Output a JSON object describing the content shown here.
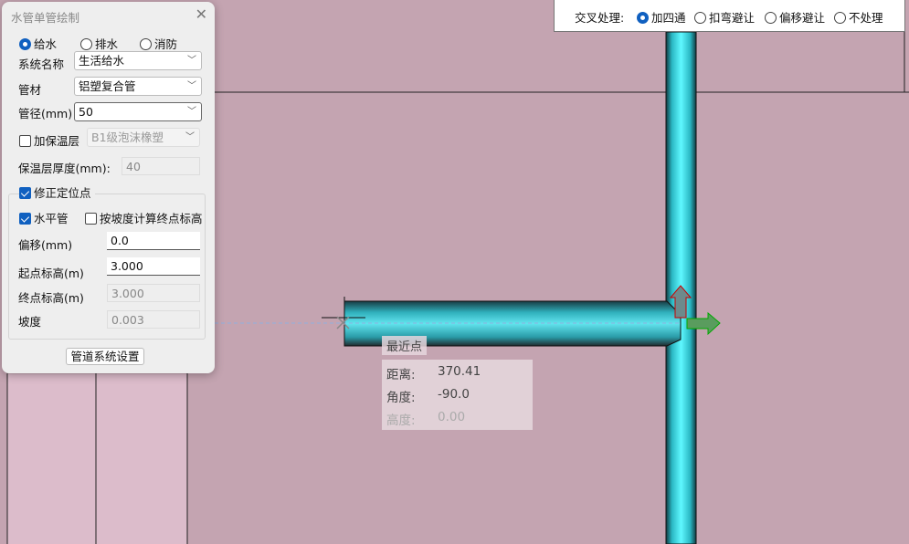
{
  "dialog": {
    "title": "水管单管绘制",
    "close": "✕",
    "types": [
      "给水",
      "排水",
      "消防"
    ],
    "system_label": "系统名称",
    "system_value": "生活给水",
    "material_label": "管材",
    "material_value": "铝塑复合管",
    "diameter_label": "管径(mm)",
    "diameter_value": "50",
    "insulation_label": "加保温层",
    "insulation_value": "B1级泡沫橡塑",
    "thickness_label": "保温层厚度(mm):",
    "thickness_value": "40",
    "fix_point_label": "修正定位点",
    "horizontal_label": "水平管",
    "slope_calc_label": "按坡度计算终点标高",
    "offset_label": "偏移(mm)",
    "offset_value": "0.0",
    "start_label": "起点标高(m)",
    "start_value": "3.000",
    "end_label": "终点标高(m)",
    "end_value": "3.000",
    "slope_label": "坡度",
    "slope_value": "0.003",
    "settings_button": "管道系统设置"
  },
  "crossing": {
    "label": "交叉处理:",
    "options": [
      "加四通",
      "扣弯避让",
      "偏移避让",
      "不处理"
    ],
    "selected": 0
  },
  "snap": {
    "title": "最近点",
    "distance_label": "距离:",
    "distance_value": "370.41",
    "angle_label": "角度:",
    "angle_value": "-90.0",
    "height_label": "高度:",
    "height_value": "0.00"
  },
  "colors": {
    "pipe": "#50e0ec",
    "background": "#c4a4b1",
    "accent": "#1060c0"
  }
}
